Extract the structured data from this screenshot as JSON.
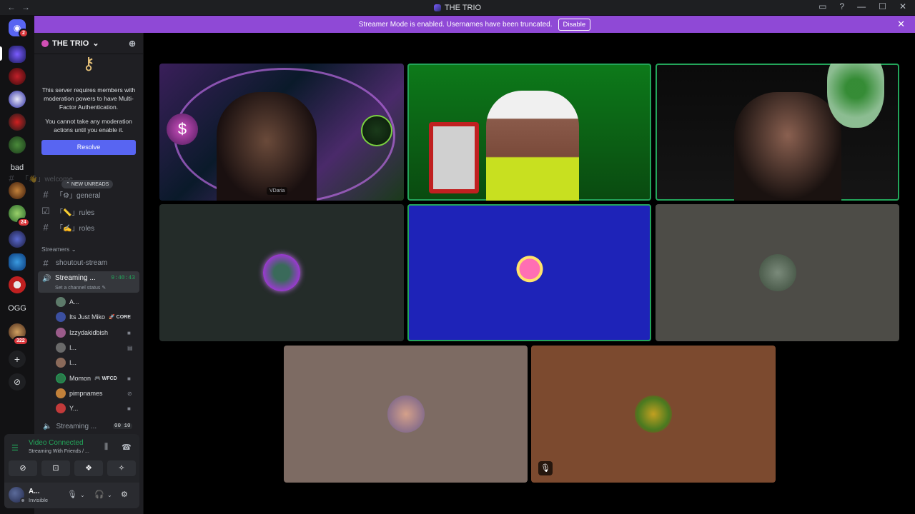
{
  "window": {
    "title": "THE TRIO",
    "nav_back": "←",
    "nav_forward": "→",
    "controls": [
      "▭",
      "?",
      "—",
      "☐",
      "✕"
    ]
  },
  "banner": {
    "text": "Streamer Mode is enabled. Usernames have been truncated.",
    "button": "Disable",
    "close": "✕"
  },
  "rail": {
    "home_badge": "2",
    "text_servers": [
      "bad",
      "OGG"
    ],
    "badges": [
      "24",
      "322"
    ],
    "add_icon": "+",
    "discover_icon": "⊘"
  },
  "server": {
    "name": "THE TRIO",
    "chevron": "⌄",
    "invite_icon": "person-add-icon"
  },
  "mfa_notice": {
    "line1": "This server requires members with moderation powers to have Multi-Factor Authentication.",
    "line2": "You cannot take any moderation actions until you enable it.",
    "button": "Resolve"
  },
  "channels": {
    "new_unreads": "NEW UNREADS",
    "items": [
      {
        "icon": "#",
        "label": "「⚙」general"
      },
      {
        "icon": "☑",
        "label": "「📏」rules"
      },
      {
        "icon": "#",
        "label": "「✍」roles"
      }
    ],
    "partial_top": "「👋」welcome",
    "category": "Streamers",
    "shoutout": "shoutout-stream"
  },
  "voice_channel": {
    "name": "Streaming ...",
    "status": "Set a channel status ✎",
    "timer": "9:40:43",
    "members": [
      {
        "name": "A...",
        "tag": "",
        "color": "#5d7a6a"
      },
      {
        "name": "Its Just Miko",
        "tag": "🚀 CORE",
        "color": "#3b4fa0"
      },
      {
        "name": "Izzydakidbish",
        "tag": "",
        "color": "#9a5b8a"
      },
      {
        "name": "I...",
        "tag": "",
        "color": "#6a6a6a"
      },
      {
        "name": "I...",
        "tag": "",
        "color": "#8a6a5a"
      },
      {
        "name": "Momon",
        "tag": "🎮 WFCD",
        "color": "#2a7a4a"
      },
      {
        "name": "pimpnames",
        "tag": "",
        "color": "#c2813a"
      },
      {
        "name": "Y...",
        "tag": "",
        "color": "#c23a3a"
      }
    ],
    "second_channel": "Streaming ...",
    "second_counts": "00 10"
  },
  "voice_panel": {
    "status": "Video Connected",
    "subtitle": "Streaming With Friends / ...",
    "buttons": [
      "⊘",
      "⊡",
      "❖",
      "✧"
    ]
  },
  "user": {
    "name": "A...",
    "status": "Invisible"
  },
  "stage": {
    "camera_label": "VDaria",
    "tiles": [
      {
        "name": "tile-top-left",
        "bg": "linear-gradient(135deg,#3a1f5a,#0a1a2a 40%,#4a2a6a 70%,#1a3a1a)",
        "speaking": false
      },
      {
        "name": "tile-top-center",
        "bg": "linear-gradient(180deg,#0d7a1a,#0a4a10)",
        "speaking": true
      },
      {
        "name": "tile-top-right",
        "bg": "linear-gradient(180deg,#0a0a0a,#151515)",
        "speaking": true
      },
      {
        "name": "tile-mid-left",
        "bg": "#242c29",
        "speaking": false,
        "avatar": "radial-gradient(circle,#3a6a5a 30%,#9a3ad0 70%)"
      },
      {
        "name": "tile-mid-center",
        "bg": "#1e23b8",
        "speaking": true,
        "avatar": "radial-gradient(circle at 50% 40%,#ff6fb3 35%,#ffe36a 36%,#ffe36a 45%,#1e23b8 46%)"
      },
      {
        "name": "tile-mid-right",
        "bg": "#4d4c47",
        "speaking": false,
        "avatar": "radial-gradient(circle,#7a8a7a,#3a4a3a)"
      },
      {
        "name": "tile-bottom-left",
        "bg": "#7d6b63",
        "speaking": false,
        "avatar": "radial-gradient(circle,#d4a08a,#6a5a8a)"
      },
      {
        "name": "tile-bottom-right",
        "bg": "#7c4a2f",
        "speaking": false,
        "avatar": "radial-gradient(circle,#c2a020,#4a7a20 60%,#a03020)",
        "muted_icon": "🎙"
      }
    ]
  }
}
